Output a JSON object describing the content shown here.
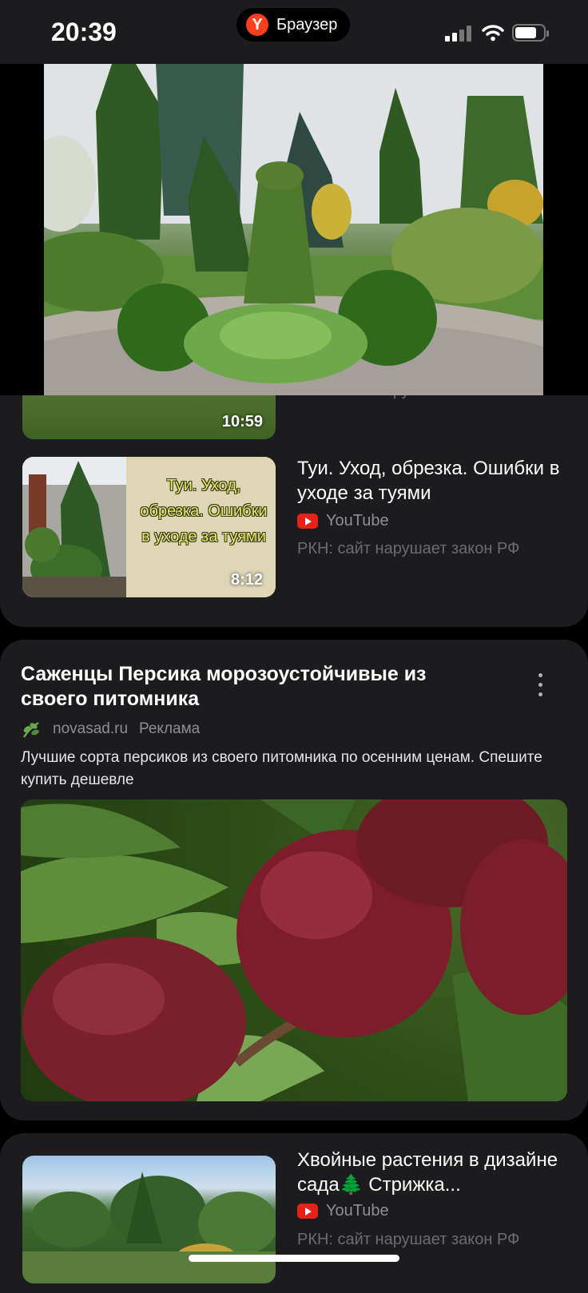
{
  "status_bar": {
    "time": "20:39",
    "app_name": "Браузер"
  },
  "videos": [
    {
      "duration": "10:59",
      "rkn": "РКН: сайт нарушает закон РФ"
    },
    {
      "title": "Туи. Уход, обрезка. Ошибки в уходе за туями",
      "thumb_text": "Туи. Уход, обрезка. Ошибки в уходе за туями",
      "duration": "8:12",
      "source": "YouTube",
      "rkn": "РКН: сайт нарушает закон РФ"
    },
    {
      "title": "Хвойные растения в дизайне сада🌲 Стрижка...",
      "source": "YouTube",
      "rkn": "РКН: сайт нарушает закон РФ"
    }
  ],
  "ad": {
    "title": "Саженцы Персика морозоустойчивые из своего питомника",
    "domain": "novasad.ru",
    "label": "Реклама",
    "description": "Лучшие сорта персиков из своего питомника по осенним ценам. Спешите купить дешевле"
  },
  "colors": {
    "card_bg": "#1c1c1e",
    "youtube_red": "#e62117",
    "yandex_red": "#fc3f1d"
  }
}
